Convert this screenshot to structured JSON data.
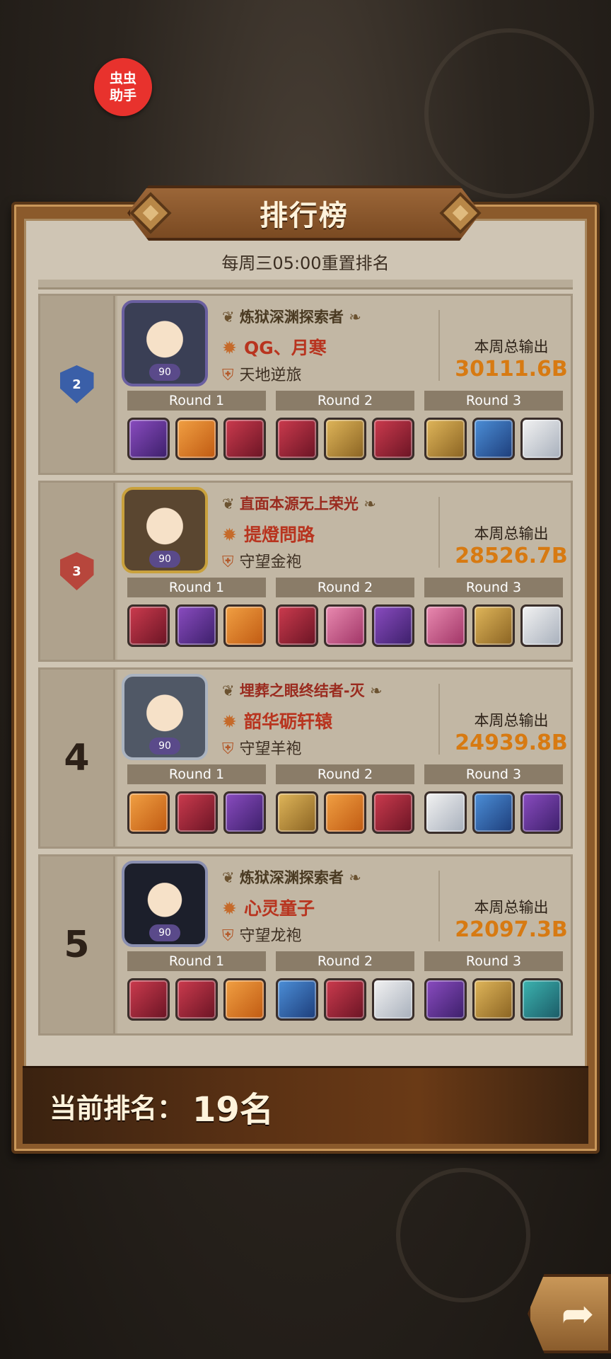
{
  "helper_badge": "虫虫助手",
  "title": "排行榜",
  "subtitle": "每周三05:00重置排名",
  "output_label": "本周总输出",
  "round_labels": [
    "Round 1",
    "Round 2",
    "Round 3"
  ],
  "entries": [
    {
      "rank": "2",
      "rank_style": "shield-blue",
      "level": "90",
      "title": "炼狱深渊探索者",
      "title_style": "gold",
      "name": "QG、月寒",
      "guild": "天地逆旅",
      "output": "30111.6B",
      "heroes": [
        [
          "purple",
          "orange",
          "red"
        ],
        [
          "red",
          "gold",
          "red"
        ],
        [
          "gold",
          "blue",
          "white"
        ]
      ]
    },
    {
      "rank": "3",
      "rank_style": "shield-red",
      "level": "90",
      "title": "直面本源无上荣光",
      "title_style": "red",
      "name": "提燈問路",
      "guild": "守望金袍",
      "output": "28526.7B",
      "heroes": [
        [
          "red",
          "purple",
          "orange"
        ],
        [
          "red",
          "pink",
          "purple"
        ],
        [
          "pink",
          "gold",
          "white"
        ]
      ]
    },
    {
      "rank": "4",
      "rank_style": "number",
      "level": "90",
      "title": "埋葬之眼终结者-灭",
      "title_style": "red",
      "name": "韶华砺轩辕",
      "guild": "守望羊袍",
      "output": "24939.8B",
      "heroes": [
        [
          "orange",
          "red",
          "purple"
        ],
        [
          "gold",
          "orange",
          "red"
        ],
        [
          "white",
          "blue",
          "purple"
        ]
      ]
    },
    {
      "rank": "5",
      "rank_style": "number",
      "level": "90",
      "title": "炼狱深渊探索者",
      "title_style": "gold",
      "name": "心灵童子",
      "guild": "守望龙袍",
      "output": "22097.3B",
      "heroes": [
        [
          "red",
          "red",
          "orange"
        ],
        [
          "blue",
          "red",
          "white"
        ],
        [
          "purple",
          "gold",
          "teal"
        ]
      ]
    }
  ],
  "current_rank": {
    "label": "当前排名：",
    "value": "19名"
  },
  "icons": {
    "share": "share-arrow-icon",
    "star": "star-icon",
    "guild": "guild-emblem-icon"
  }
}
